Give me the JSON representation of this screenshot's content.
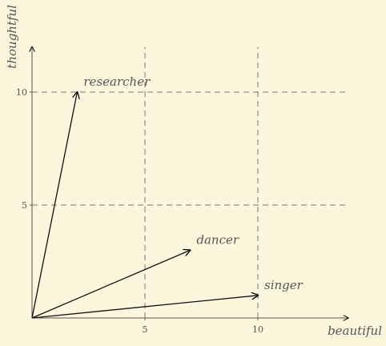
{
  "chart_data": {
    "type": "vector-plot",
    "xlabel": "beautiful",
    "ylabel": "thoughtful",
    "xlim": [
      0,
      14
    ],
    "ylim": [
      0,
      12
    ],
    "x_ticks": [
      5,
      10
    ],
    "y_ticks": [
      5,
      10
    ],
    "grid": "dashed",
    "vectors": [
      {
        "label": "researcher",
        "x": 2,
        "y": 10
      },
      {
        "label": "dancer",
        "x": 7,
        "y": 3
      },
      {
        "label": "singer",
        "x": 10,
        "y": 1
      }
    ]
  }
}
